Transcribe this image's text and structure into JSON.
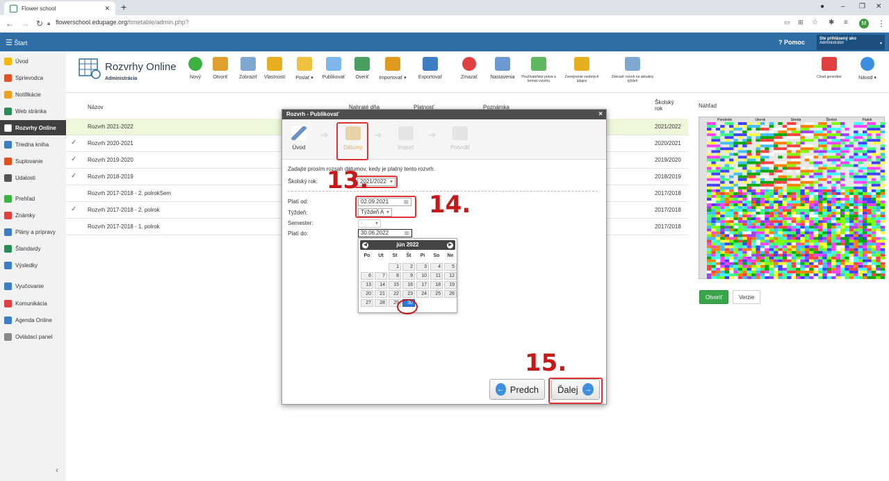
{
  "browser": {
    "tab_title": "Flower school",
    "url_host": "flowerschool.edupage.org",
    "url_path": "/timetable/admin.php?",
    "profile_initial": "M"
  },
  "header": {
    "start": "Štart",
    "help": "Pomoc",
    "logged_as": "Ste prihlásený ako",
    "role": "Administrátor"
  },
  "sidebar": {
    "items": [
      {
        "label": "Úvod",
        "color": "#f5b800"
      },
      {
        "label": "Sprievodca",
        "color": "#e0532a"
      },
      {
        "label": "Notifikácie",
        "color": "#f0a020"
      },
      {
        "label": "Web stránka",
        "color": "#2e8b57"
      },
      {
        "label": "Rozvrhy Online",
        "color": "#ffffff"
      },
      {
        "label": "Triedna kniha",
        "color": "#3c7dc4"
      },
      {
        "label": "Suplovanie",
        "color": "#e05020"
      },
      {
        "label": "Udalosti",
        "color": "#555555"
      },
      {
        "label": "Prehľad",
        "color": "#3cb040"
      },
      {
        "label": "Známky",
        "color": "#e04040"
      },
      {
        "label": "Plány a prípravy",
        "color": "#3c7dc4"
      },
      {
        "label": "Štandardy",
        "color": "#2e8b57"
      },
      {
        "label": "Výsledky",
        "color": "#3c7dc4"
      },
      {
        "label": "Vyučovanie",
        "color": "#3c7dc4"
      },
      {
        "label": "Komunikácia",
        "color": "#e04040"
      },
      {
        "label": "Agenda Online",
        "color": "#3c7dc4"
      },
      {
        "label": "Ovládací panel",
        "color": "#888888"
      }
    ]
  },
  "app": {
    "title": "Rozvrhy Online",
    "subtitle": "Administrácia"
  },
  "toolbar": {
    "buttons": [
      {
        "label": "Nový",
        "color": "#3cb040"
      },
      {
        "label": "Otvoriť",
        "color": "#e0a030"
      },
      {
        "label": "Zobraziť",
        "color": "#7fa8d0"
      },
      {
        "label": "Vlastnosti",
        "color": "#e8b020"
      },
      {
        "label": "Poslať ▾",
        "color": "#f0c040"
      },
      {
        "label": "Publikovať",
        "color": "#7fb8e8"
      },
      {
        "label": "Overiť",
        "color": "#4aa060"
      },
      {
        "label": "Importovať ▾",
        "color": "#e09a20"
      },
      {
        "label": "Exportovať",
        "color": "#3c7dc4"
      },
      {
        "label": "Zmazať",
        "color": "#e04040"
      },
      {
        "label": "Nastavenia",
        "color": "#6a9ad0"
      },
      {
        "label": "Používateľské práva a formát rozvrhu",
        "color": "#5fb860"
      },
      {
        "label": "Zverejnenie osobných údajov",
        "color": "#e8b020"
      },
      {
        "label": "Zobraziť rozvrh na aktuálny týždeň",
        "color": "#7fa8d0"
      },
      {
        "label": "Cloud generátor",
        "color": "#e04040"
      },
      {
        "label": "Návod ▾",
        "color": "#3c8fe0"
      }
    ]
  },
  "table": {
    "headers": {
      "name": "Názov",
      "loaded": "Nahraté dňa",
      "valid": "Platnosť",
      "note": "Poznámka",
      "year": "Školský rok"
    },
    "rows": [
      {
        "name": "Rozvrh 2021-2022",
        "year": "2021/2022",
        "check": ""
      },
      {
        "name": "Rozvrh 2020-2021",
        "year": "2020/2021",
        "check": "✓"
      },
      {
        "name": "Rozvrh 2019-2020",
        "year": "2019/2020",
        "check": "✓"
      },
      {
        "name": "Rozvrh 2018-2019",
        "year": "2018/2019",
        "check": "✓"
      },
      {
        "name": "Rozvrh 2017-2018 - 2. polrokSem",
        "year": "2017/2018",
        "check": ""
      },
      {
        "name": "Rozvrh 2017-2018 - 2. polrok",
        "year": "2017/2018",
        "check": "✓"
      },
      {
        "name": "Rozvrh 2017-2018 - 1. polrok",
        "year": "2017/2018",
        "check": ""
      }
    ]
  },
  "preview": {
    "title": "Náhľad",
    "days": [
      "Pondelok",
      "Utorok",
      "Streda",
      "Štvrtok",
      "Piatok"
    ],
    "open_label": "Otvoriť",
    "versions_label": "Verzie"
  },
  "dialog": {
    "title": "Rozvrh - Publikovať",
    "close": "×",
    "steps": [
      "Úvod",
      "Dátumy",
      "Import",
      "Potvrdiť"
    ],
    "intro": "Zadajte prosím rozsah dátumov, kedy je platný tento rozvrh.",
    "school_year_label": "Školský rok:",
    "school_year_value": "2021/2022",
    "valid_from_label": "Platí od:",
    "valid_from_value": "02.09.2021",
    "week_label": "Týždeň:",
    "week_value": "Týždeň A",
    "semester_label": "Semester:",
    "semester_value": "-",
    "valid_to_label": "Platí do:",
    "valid_to_value": "30.06.2022",
    "prev_label": "Predch",
    "next_label": "Ďalej"
  },
  "calendar": {
    "month": "jún 2022",
    "dow": [
      "Po",
      "Ut",
      "St",
      "Št",
      "Pi",
      "So",
      "Ne"
    ],
    "weeks": [
      [
        "",
        "",
        "1",
        "2",
        "3",
        "4",
        "5"
      ],
      [
        "6",
        "7",
        "8",
        "9",
        "10",
        "11",
        "12"
      ],
      [
        "13",
        "14",
        "15",
        "16",
        "17",
        "18",
        "19"
      ],
      [
        "20",
        "21",
        "22",
        "23",
        "24",
        "25",
        "26"
      ],
      [
        "27",
        "28",
        "29",
        "30",
        "",
        "",
        ""
      ]
    ],
    "selected": "30"
  },
  "annotations": {
    "a13": "13.",
    "a14": "14.",
    "a15": "15."
  },
  "colors": {
    "accent": "#2f6ea5",
    "selected_row": "#eef7d9",
    "annotation": "#c41a1a"
  }
}
